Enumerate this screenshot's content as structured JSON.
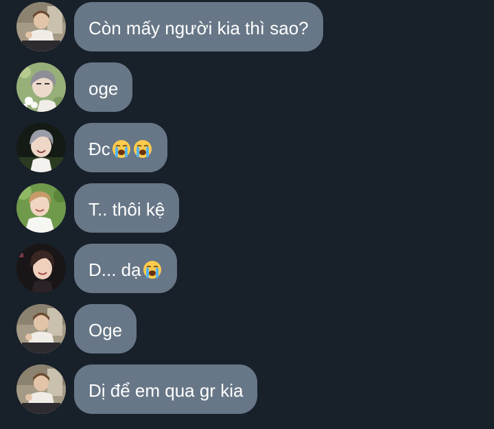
{
  "messages": [
    {
      "avatar": "avatar-sitting-portrait",
      "text": "Còn mấy người kia thì sao?",
      "emojis": []
    },
    {
      "avatar": "avatar-gray-hair-flowers",
      "text": "oge",
      "emojis": []
    },
    {
      "avatar": "avatar-gray-hair-smiling",
      "text": "Đc",
      "emojis": [
        "loudly-crying-face-icon",
        "loudly-crying-face-icon"
      ]
    },
    {
      "avatar": "avatar-outdoor-green",
      "text": "T.. thôi kệ",
      "emojis": []
    },
    {
      "avatar": "avatar-dark-hair-smiling",
      "text": "D... dạ",
      "emojis": [
        "loudly-crying-face-icon"
      ]
    },
    {
      "avatar": "avatar-sitting-portrait",
      "text": "Oge",
      "emojis": []
    },
    {
      "avatar": "avatar-sitting-portrait",
      "text": "Dị để em qua gr kia",
      "emojis": []
    }
  ],
  "colors": {
    "background": "#18202a",
    "bubble": "#677787",
    "text": "#ffffff"
  }
}
